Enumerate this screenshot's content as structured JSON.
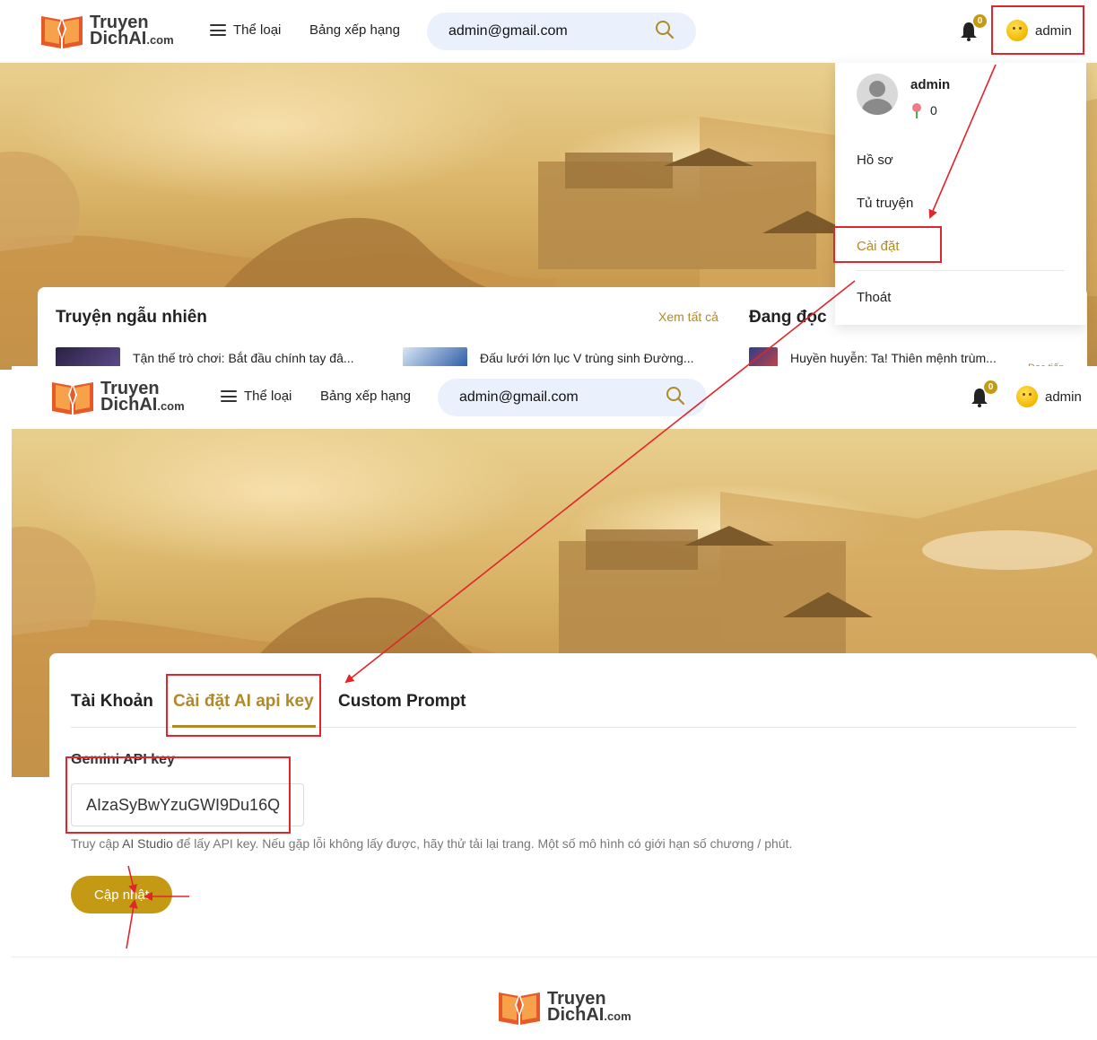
{
  "brand": {
    "line1": "Truyen",
    "line2": "DichAI",
    "suffix": ".com"
  },
  "nav": {
    "genres_label": "Thể loại",
    "rankings_label": "Bảng xếp hạng"
  },
  "search": {
    "value": "admin@gmail.com"
  },
  "notifications": {
    "count": "0"
  },
  "user": {
    "name": "admin"
  },
  "dropdown": {
    "name": "admin",
    "points": "0",
    "items": [
      {
        "label": "Hồ sơ"
      },
      {
        "label": "Tủ truyện"
      },
      {
        "label": "Cài đặt"
      },
      {
        "label": "Thoát"
      }
    ]
  },
  "home": {
    "random_title": "Truyện ngẫu nhiên",
    "see_all": "Xem tất cả",
    "reading_title": "Đang đọc",
    "reading_more": "Đọc tiếp",
    "stories": [
      {
        "title": "Tận thế trò chơi: Bắt đầu chính tay đâ..."
      },
      {
        "title": "Đấu lưới lớn lục V trùng sinh Đường..."
      },
      {
        "title": "Huyền huyễn: Ta! Thiên mệnh trùm..."
      }
    ]
  },
  "settings": {
    "tabs": [
      {
        "label": "Tài Khoản"
      },
      {
        "label": "Cài đặt AI api key"
      },
      {
        "label": "Custom Prompt"
      }
    ],
    "active_tab": "Cài đặt AI api key",
    "field_label": "Gemini API key",
    "field_value": "AIzaSyBwYzuGWI9Du16Q",
    "help_prefix": "Truy cập ",
    "help_link": "AI Studio",
    "help_suffix": " để lấy API key. Nếu gặp lỗi không lấy được, hãy thử tải lại trang. Một số mô hình có giới hạn số chương / phút.",
    "submit_label": "Cập nhật"
  },
  "colors": {
    "accent": "#b08a26",
    "button": "#c49a14",
    "search_bg": "#eaf1fd",
    "annotation": "#e0262d"
  },
  "icons": [
    "hamburger-icon",
    "search-icon",
    "bell-icon",
    "emoji-avatar-icon",
    "rose-icon",
    "user-avatar-icon"
  ]
}
